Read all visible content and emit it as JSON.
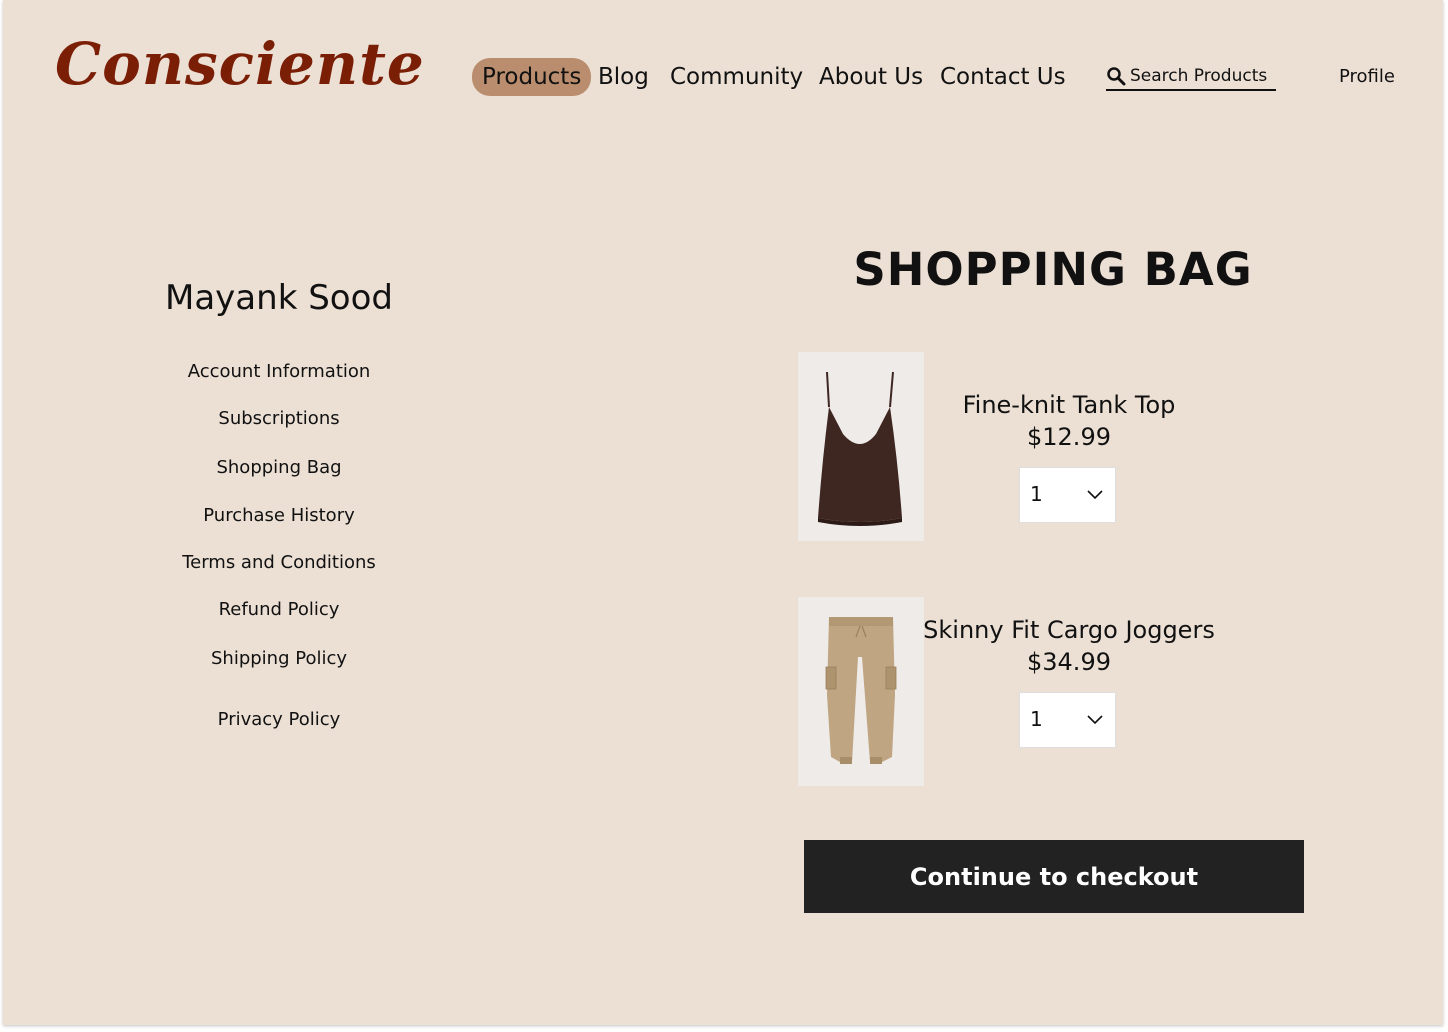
{
  "brand": {
    "logo_text": "Consciente",
    "logo_color": "#7a1e05"
  },
  "nav": {
    "items": [
      {
        "label": "Products",
        "active": true
      },
      {
        "label": "Blog",
        "active": false
      },
      {
        "label": "Community",
        "active": false
      },
      {
        "label": "About Us",
        "active": false
      },
      {
        "label": "Contact Us",
        "active": false
      }
    ],
    "active_color": "#b98d6d"
  },
  "search": {
    "placeholder": "Search Products",
    "icon": "search-icon"
  },
  "profile": {
    "label": "Profile"
  },
  "sidebar": {
    "user_name": "Mayank Sood",
    "items": [
      {
        "label": "Account Information"
      },
      {
        "label": "Subscriptions"
      },
      {
        "label": "Shopping Bag"
      },
      {
        "label": "Purchase History"
      },
      {
        "label": "Terms and Conditions"
      },
      {
        "label": "Refund Policy"
      },
      {
        "label": "Shipping Policy"
      },
      {
        "label": "Privacy Policy"
      }
    ]
  },
  "bag": {
    "title": "SHOPPING BAG",
    "products": [
      {
        "name": "Fine-knit Tank Top",
        "price": "$12.99",
        "quantity": "1",
        "image": "tank-top-image",
        "color": "#3e2621"
      },
      {
        "name": "Skinny Fit Cargo Joggers",
        "price": "$34.99",
        "quantity": "1",
        "image": "cargo-joggers-image",
        "color": "#bfa582"
      }
    ],
    "checkout_label": "Continue to checkout"
  },
  "colors": {
    "background": "#ece0d5",
    "checkout_button": "#222222"
  }
}
